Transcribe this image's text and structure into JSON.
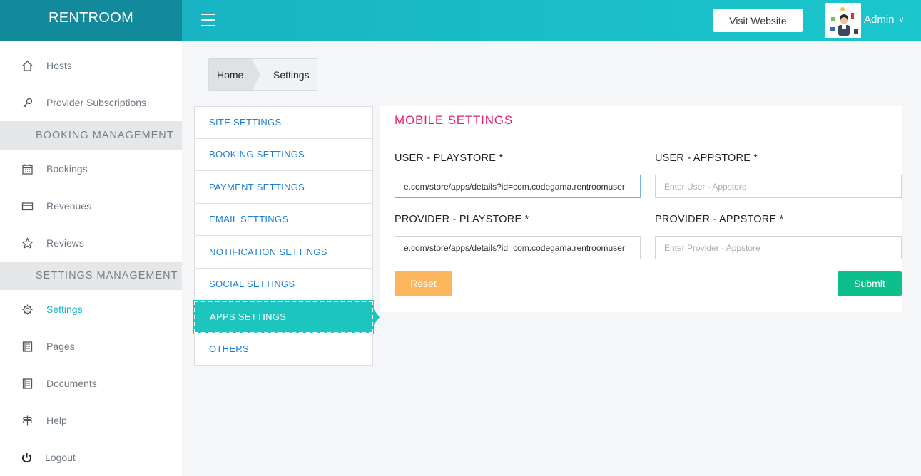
{
  "brand": "RENTROOM",
  "header": {
    "visit_label": "Visit Website",
    "user_name": "Admin"
  },
  "sidebar": {
    "items": [
      {
        "label": "Hosts",
        "icon": "home-icon"
      },
      {
        "label": "Provider Subscriptions",
        "icon": "key-icon"
      },
      {
        "label": "Bookings",
        "icon": "calendar-icon"
      },
      {
        "label": "Revenues",
        "icon": "credit-card-icon"
      },
      {
        "label": "Reviews",
        "icon": "star-icon"
      },
      {
        "label": "Settings",
        "icon": "gear-icon",
        "active": true
      },
      {
        "label": "Pages",
        "icon": "book-icon"
      },
      {
        "label": "Documents",
        "icon": "book-icon"
      },
      {
        "label": "Help",
        "icon": "signpost-icon"
      },
      {
        "label": "Logout",
        "icon": "power-icon"
      }
    ],
    "sections": [
      "BOOKING MANAGEMENT",
      "SETTINGS MANAGEMENT"
    ]
  },
  "breadcrumb": {
    "home": "Home",
    "current": "Settings"
  },
  "settings_menu": [
    "SITE SETTINGS",
    "BOOKING SETTINGS",
    "PAYMENT SETTINGS",
    "EMAIL SETTINGS",
    "NOTIFICATION SETTINGS",
    "SOCIAL SETTINGS",
    "APPS SETTINGS",
    "OTHERS"
  ],
  "panel": {
    "title": "MOBILE SETTINGS",
    "user_playstore": {
      "label": "USER - PLAYSTORE *",
      "value": "e.com/store/apps/details?id=com.codegama.rentroomuser"
    },
    "user_appstore": {
      "label": "USER - APPSTORE *",
      "placeholder": "Enter User - Appstore"
    },
    "provider_playstore": {
      "label": "PROVIDER - PLAYSTORE *",
      "value": "e.com/store/apps/details?id=com.codegama.rentroomuser"
    },
    "provider_appstore": {
      "label": "PROVIDER - APPSTORE *",
      "placeholder": "Enter Provider - Appstore"
    },
    "reset_label": "Reset",
    "submit_label": "Submit"
  },
  "colors": {
    "brand": "#138a9b",
    "accent": "#1cc5bd",
    "title": "#e6206f",
    "reset": "#fcb65e",
    "submit": "#0cbf8c"
  }
}
